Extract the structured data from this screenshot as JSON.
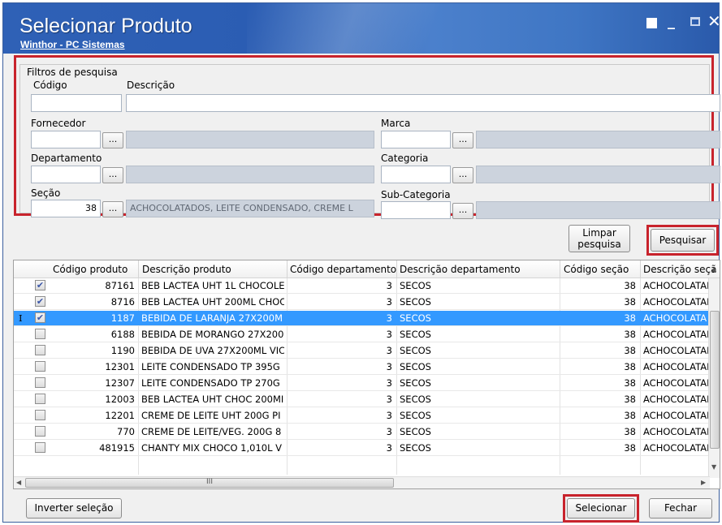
{
  "window": {
    "title": "Selecionar Produto",
    "subtitle": "Winthor - PC Sistemas"
  },
  "filters": {
    "group_label": "Filtros de pesquisa",
    "codigo_label": "Código",
    "codigo_value": "",
    "descricao_label": "Descrição",
    "descricao_value": "",
    "fornecedor_label": "Fornecedor",
    "marca_label": "Marca",
    "departamento_label": "Departamento",
    "categoria_label": "Categoria",
    "secao_label": "Seção",
    "secao_code": "38",
    "secao_desc": "ACHOCOLATADOS, LEITE CONDENSADO, CREME L",
    "subcategoria_label": "Sub-Categoria",
    "lookup_label": "..."
  },
  "actions": {
    "limpar_label": "Limpar pesquisa",
    "pesquisar_label": "Pesquisar",
    "inverter_label": "Inverter seleção",
    "selecionar_label": "Selecionar",
    "fechar_label": "Fechar"
  },
  "grid": {
    "columns": [
      "Código produto",
      "Descrição produto",
      "Código departamento",
      "Descrição departamento",
      "Código seção",
      "Descrição seçã"
    ],
    "rows": [
      {
        "checked": true,
        "selected": false,
        "codigo": "87161",
        "descricao": "BEB LACTEA UHT 1L CHOCOLE",
        "cod_dep": "3",
        "desc_dep": "SECOS",
        "cod_sec": "38",
        "desc_sec": "ACHOCOLATAI"
      },
      {
        "checked": true,
        "selected": false,
        "codigo": "8716",
        "descricao": "BEB LACTEA UHT 200ML CHOC",
        "cod_dep": "3",
        "desc_dep": "SECOS",
        "cod_sec": "38",
        "desc_sec": "ACHOCOLATAI"
      },
      {
        "checked": true,
        "selected": true,
        "codigo": "1187",
        "descricao": "BEBIDA DE LARANJA 27X200M",
        "cod_dep": "3",
        "desc_dep": "SECOS",
        "cod_sec": "38",
        "desc_sec": "ACHOCOLATA"
      },
      {
        "checked": false,
        "selected": false,
        "codigo": "6188",
        "descricao": "BEBIDA DE MORANGO 27X200",
        "cod_dep": "3",
        "desc_dep": "SECOS",
        "cod_sec": "38",
        "desc_sec": "ACHOCOLATAI"
      },
      {
        "checked": false,
        "selected": false,
        "codigo": "1190",
        "descricao": "BEBIDA DE UVA 27X200ML VIC",
        "cod_dep": "3",
        "desc_dep": "SECOS",
        "cod_sec": "38",
        "desc_sec": "ACHOCOLATAI"
      },
      {
        "checked": false,
        "selected": false,
        "codigo": "12301",
        "descricao": "LEITE CONDENSADO TP 395G",
        "cod_dep": "3",
        "desc_dep": "SECOS",
        "cod_sec": "38",
        "desc_sec": "ACHOCOLATAI"
      },
      {
        "checked": false,
        "selected": false,
        "codigo": "12307",
        "descricao": "LEITE CONDENSADO TP 270G",
        "cod_dep": "3",
        "desc_dep": "SECOS",
        "cod_sec": "38",
        "desc_sec": "ACHOCOLATAI"
      },
      {
        "checked": false,
        "selected": false,
        "codigo": "12003",
        "descricao": "BEB LACTEA UHT CHOC 200MI",
        "cod_dep": "3",
        "desc_dep": "SECOS",
        "cod_sec": "38",
        "desc_sec": "ACHOCOLATAI"
      },
      {
        "checked": false,
        "selected": false,
        "codigo": "12201",
        "descricao": "CREME DE LEITE UHT 200G PI",
        "cod_dep": "3",
        "desc_dep": "SECOS",
        "cod_sec": "38",
        "desc_sec": "ACHOCOLATAI"
      },
      {
        "checked": false,
        "selected": false,
        "codigo": "770",
        "descricao": "CREME DE LEITE/VEG. 200G 8",
        "cod_dep": "3",
        "desc_dep": "SECOS",
        "cod_sec": "38",
        "desc_sec": "ACHOCOLATAI"
      },
      {
        "checked": false,
        "selected": false,
        "codigo": "481915",
        "descricao": "CHANTY MIX CHOCO 1,010L V",
        "cod_dep": "3",
        "desc_dep": "SECOS",
        "cod_sec": "38",
        "desc_sec": "ACHOCOLATAI"
      }
    ],
    "row_cursor": "I",
    "scroll_grip": "III"
  },
  "colors": {
    "title_bar": "#2f61b6",
    "highlight_border": "#c8232c",
    "selected_row": "#3399ff"
  }
}
